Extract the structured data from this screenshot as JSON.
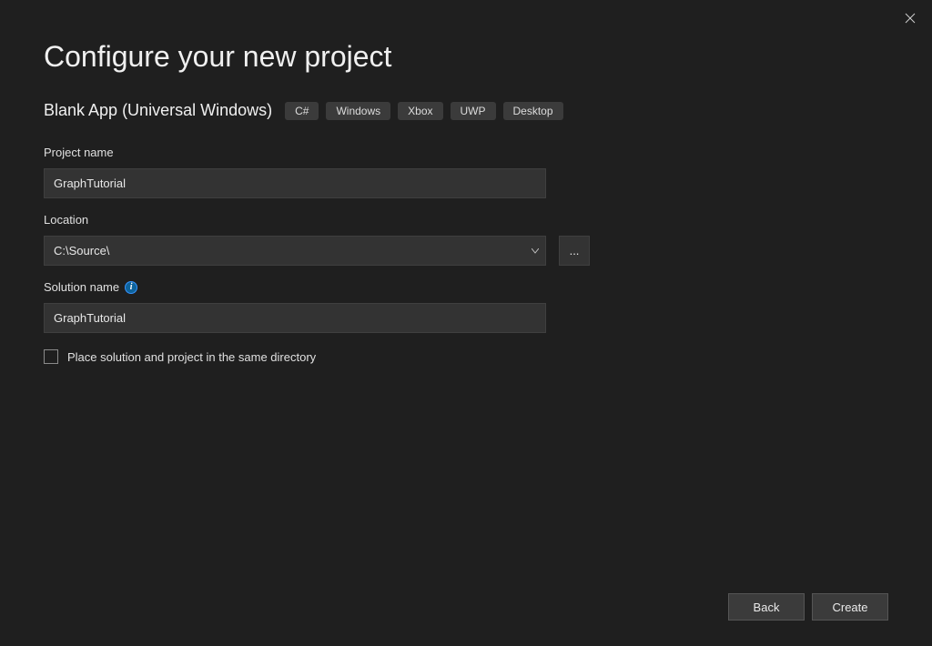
{
  "page_title": "Configure your new project",
  "template": {
    "name": "Blank App (Universal Windows)",
    "tags": [
      "C#",
      "Windows",
      "Xbox",
      "UWP",
      "Desktop"
    ]
  },
  "fields": {
    "project_name": {
      "label": "Project name",
      "value": "GraphTutorial"
    },
    "location": {
      "label": "Location",
      "value": "C:\\Source\\",
      "browse_label": "..."
    },
    "solution_name": {
      "label": "Solution name",
      "value": "GraphTutorial",
      "has_info": true
    },
    "same_directory": {
      "label": "Place solution and project in the same directory",
      "checked": false
    }
  },
  "footer": {
    "back_label": "Back",
    "create_label": "Create"
  }
}
